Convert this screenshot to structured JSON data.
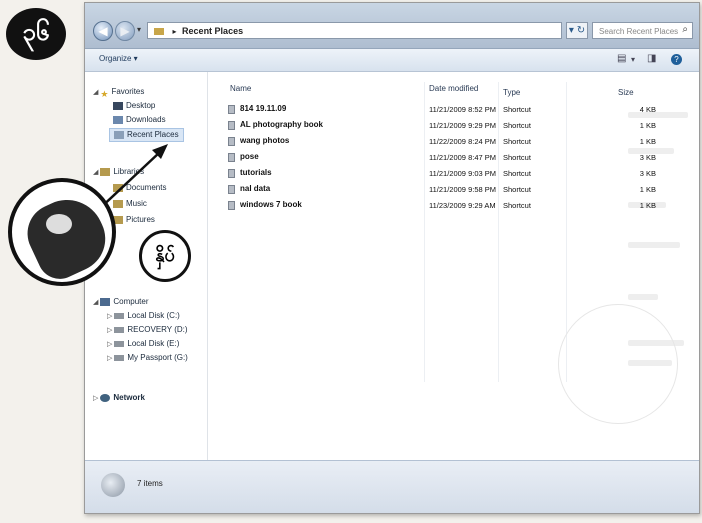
{
  "page_marker": "၃၆",
  "window": {
    "breadcrumb": {
      "root_icon": "libraries-icon",
      "current": "Recent Places"
    },
    "search": {
      "placeholder": "Search Recent Places"
    },
    "toolbar": {
      "organize_label": "Organize ▾"
    },
    "nav": {
      "favorites": {
        "label": "Favorites",
        "items": [
          {
            "label": "Desktop",
            "icon": "desktop-icon"
          },
          {
            "label": "Downloads",
            "icon": "downloads-icon"
          },
          {
            "label": "Recent Places",
            "icon": "recent-places-icon",
            "selected": true
          }
        ]
      },
      "libraries": {
        "label": "Libraries",
        "items": [
          {
            "label": "Documents",
            "icon": "documents-icon"
          },
          {
            "label": "Music",
            "icon": "music-icon"
          },
          {
            "label": "Pictures",
            "icon": "pictures-icon"
          }
        ]
      },
      "computer": {
        "label": "Computer",
        "items": [
          {
            "label": "Local Disk (C:)",
            "icon": "drive-icon"
          },
          {
            "label": "RECOVERY (D:)",
            "icon": "drive-icon"
          },
          {
            "label": "Local Disk (E:)",
            "icon": "drive-icon"
          },
          {
            "label": "My Passport (G:)",
            "icon": "drive-icon"
          }
        ]
      },
      "network": {
        "label": "Network"
      }
    },
    "columns": {
      "name": "Name",
      "date": "Date modified",
      "type": "Type",
      "size": "Size"
    },
    "files": [
      {
        "name": "814 19.11.09",
        "date": "11/21/2009 8:52 PM",
        "type": "Shortcut",
        "size": "4 KB"
      },
      {
        "name": "AL photography book",
        "date": "11/21/2009 9:29 PM",
        "type": "Shortcut",
        "size": "1 KB"
      },
      {
        "name": "wang photos",
        "date": "11/22/2009 8:24 PM",
        "type": "Shortcut",
        "size": "1 KB"
      },
      {
        "name": "pose",
        "date": "11/21/2009 8:47 PM",
        "type": "Shortcut",
        "size": "3 KB"
      },
      {
        "name": "tutorials",
        "date": "11/21/2009 9:03 PM",
        "type": "Shortcut",
        "size": "3 KB"
      },
      {
        "name": "nal data",
        "date": "11/21/2009 9:58 PM",
        "type": "Shortcut",
        "size": "1 KB"
      },
      {
        "name": "windows 7 book",
        "date": "11/23/2009 9:29 AM",
        "type": "Shortcut",
        "size": "1 KB"
      }
    ],
    "details": {
      "count_text": "7 items"
    }
  },
  "callout": {
    "label": "နှိပ်"
  }
}
